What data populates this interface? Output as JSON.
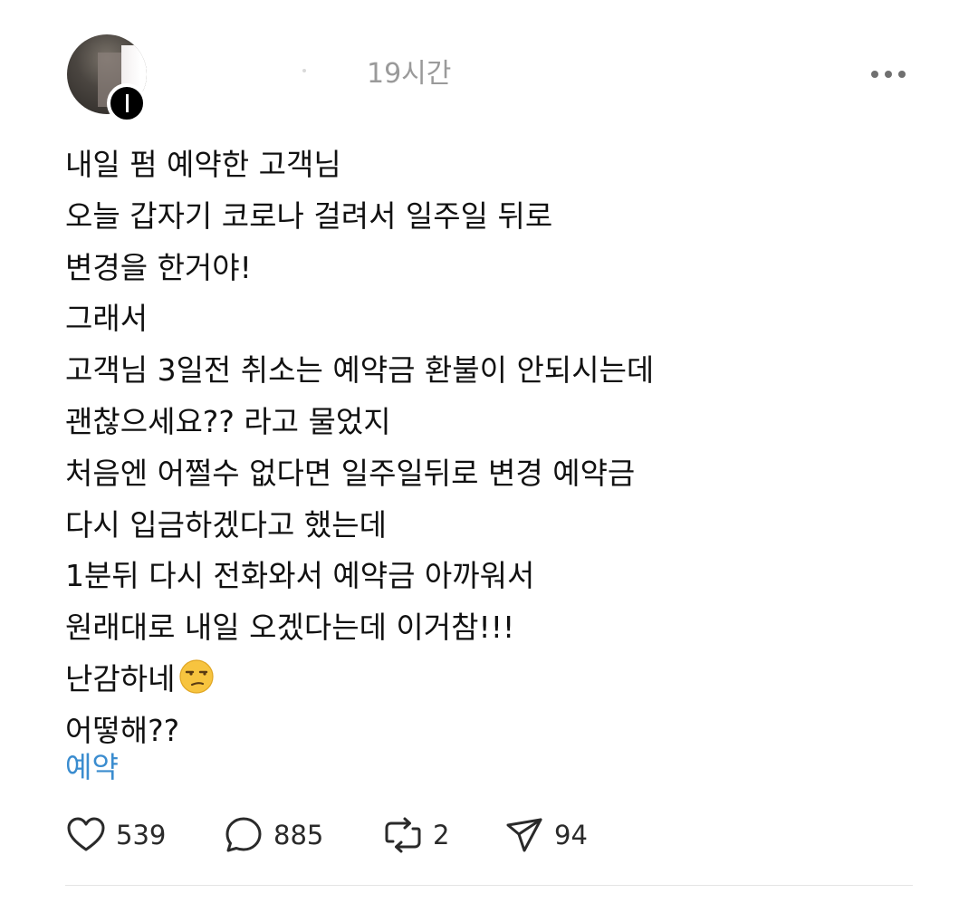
{
  "post": {
    "time": "19시간",
    "lines": [
      "내일 펌 예약한 고객님",
      "오늘 갑자기 코로나 걸려서 일주일 뒤로",
      "변경을 한거야!",
      "그래서",
      "고객님 3일전 취소는 예약금 환불이 안되시는데",
      "괜찮으세요?? 라고 물었지",
      "처음엔 어쩔수 없다면 일주일뒤로 변경 예약금",
      "다시 입금하겠다고 했는데",
      "1분뒤 다시 전화와서 예약금 아까워서",
      "원래대로 내일 오겠다는데 이거참!!!",
      "난감하네",
      "어떻해??"
    ],
    "emoji": "unamused-face",
    "tag": "예약"
  },
  "actions": {
    "like_count": "539",
    "comment_count": "885",
    "repost_count": "2",
    "share_count": "94"
  },
  "icons": [
    "heart-icon",
    "comment-icon",
    "repost-icon",
    "send-icon",
    "more-icon"
  ],
  "colors": {
    "tag": "#3a8ccf",
    "time": "#9a9a9a",
    "text": "#111111",
    "icon": "#2a2a2a"
  }
}
